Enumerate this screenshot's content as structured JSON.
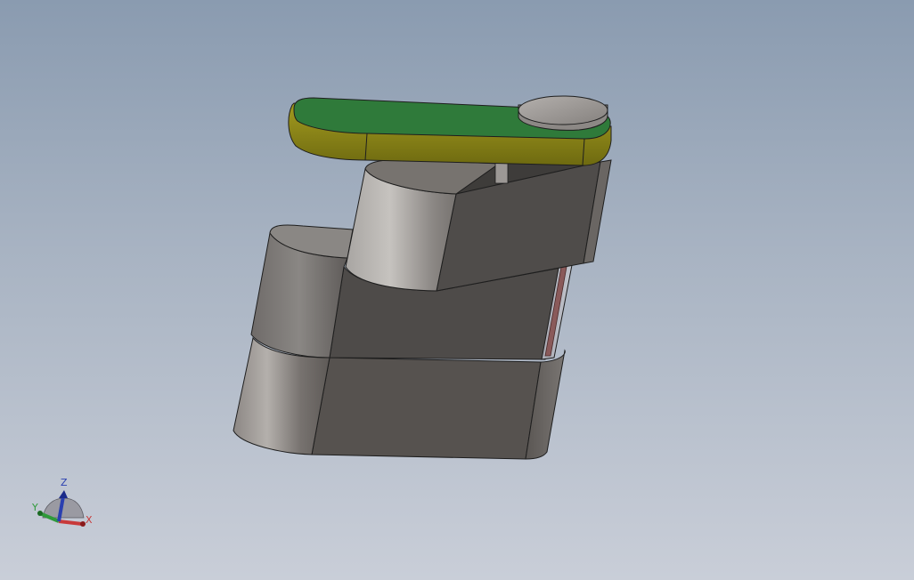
{
  "viewport": {
    "background_top": "#8a9bb0",
    "background_bottom": "#c9ced8"
  },
  "model": {
    "body_color": "#56524f",
    "top_plate_color": "#2f7a3a",
    "top_plate_edge_color": "#8c8a12",
    "boss_color": "#9a9592"
  },
  "triad": {
    "x_label": "X",
    "y_label": "Y",
    "z_label": "Z",
    "x_color": "#c83a3a",
    "y_color": "#2f9a3a",
    "z_color": "#2a3fb0"
  }
}
